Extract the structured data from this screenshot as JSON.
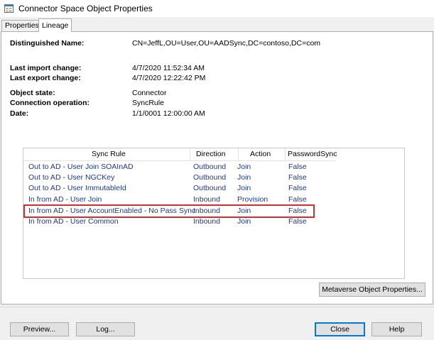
{
  "window": {
    "title": "Connector Space Object Properties",
    "icon": "connector-properties-icon"
  },
  "tabs": [
    {
      "label": "Properties",
      "selected": false
    },
    {
      "label": "Lineage",
      "selected": true
    }
  ],
  "fields": {
    "distinguished_name": {
      "label": "Distinguished Name:",
      "value": "CN=JeffL,OU=User,OU=AADSync,DC=contoso,DC=com"
    },
    "last_import_change": {
      "label": "Last import change:",
      "value": "4/7/2020 11:52:34 AM"
    },
    "last_export_change": {
      "label": "Last export change:",
      "value": "4/7/2020 12:22:42 PM"
    },
    "object_state": {
      "label": "Object state:",
      "value": "Connector"
    },
    "connection_operation": {
      "label": "Connection operation:",
      "value": "SyncRule"
    },
    "date": {
      "label": "Date:",
      "value": "1/1/0001 12:00:00 AM"
    }
  },
  "grid": {
    "columns": [
      "Sync Rule",
      "Direction",
      "Action",
      "PasswordSync"
    ],
    "rows": [
      {
        "sync_rule": "Out to AD - User Join SOAInAD",
        "direction": "Outbound",
        "action": "Join",
        "password_sync": "False"
      },
      {
        "sync_rule": "Out to AD - User NGCKey",
        "direction": "Outbound",
        "action": "Join",
        "password_sync": "False"
      },
      {
        "sync_rule": "Out to AD - User ImmutableId",
        "direction": "Outbound",
        "action": "Join",
        "password_sync": "False"
      },
      {
        "sync_rule": "In from AD - User Join",
        "direction": "Inbound",
        "action": "Provision",
        "password_sync": "False"
      },
      {
        "sync_rule": "In from AD - User AccountEnabled - No Pass Sync",
        "direction": "Inbound",
        "action": "Join",
        "password_sync": "False"
      },
      {
        "sync_rule": "In from AD - User Common",
        "direction": "Inbound",
        "action": "Join",
        "password_sync": "False"
      }
    ],
    "highlighted_row": 4,
    "highlight_color": "#d32f2f",
    "text_color": "#1c3a8c"
  },
  "buttons": {
    "metaverse": "Metaverse Object Properties...",
    "preview": "Preview...",
    "log": "Log...",
    "close": "Close",
    "help": "Help"
  }
}
